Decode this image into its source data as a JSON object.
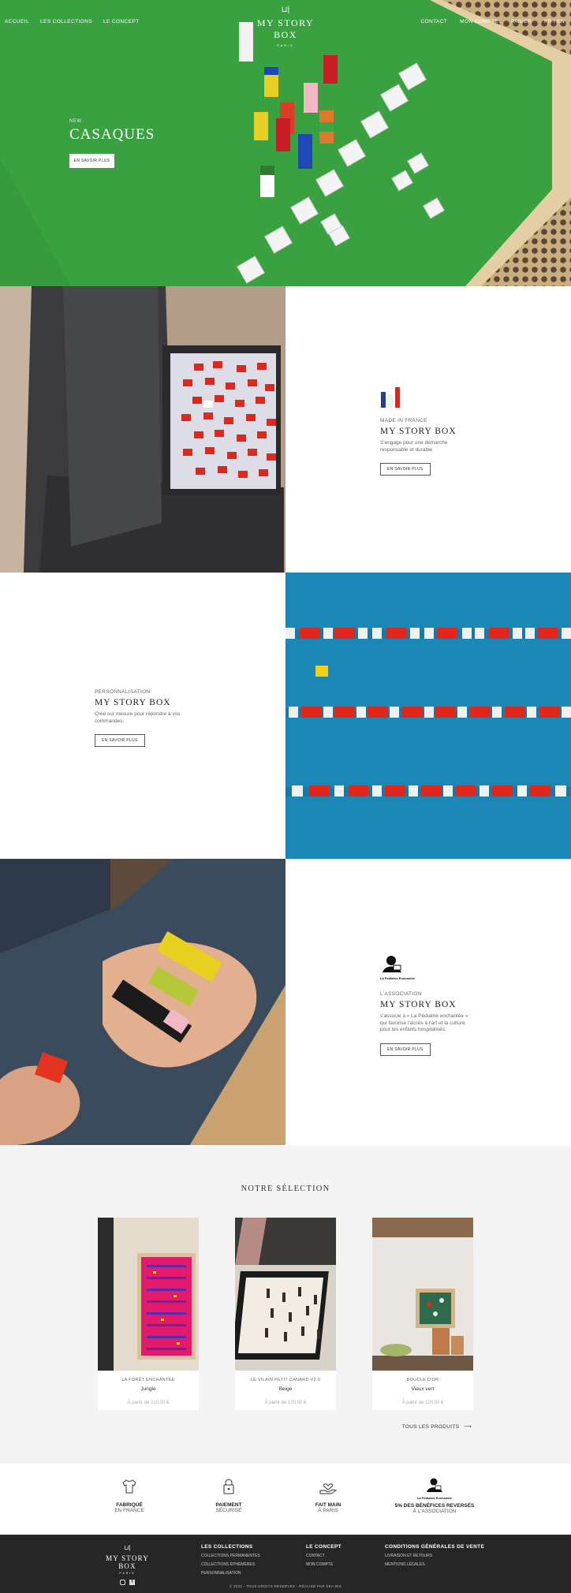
{
  "nav": {
    "left": [
      "ACCUEIL",
      "LES COLLECTIONS",
      "LE CONCEPT"
    ],
    "right": [
      "CONTACT",
      "MON COMPTE",
      "PANIER",
      "FR / EN"
    ]
  },
  "logo": {
    "name": "MY STORY BOX",
    "sub": "PARIS"
  },
  "hero": {
    "kicker": "NEW",
    "title": "CASAQUES",
    "button": "EN SAVOIR PLUS"
  },
  "sections": {
    "made_in_france": {
      "kicker": "MADE IN FRANCE",
      "title": "MY STORY BOX",
      "desc": "S'engage pour une démarche responsable et durable",
      "button": "EN SAVOIR PLUS"
    },
    "personnalisation": {
      "kicker": "PERSONNALISATION",
      "title": "MY STORY BOX",
      "desc": "Créé sur mesure pour répondre à vos commandes.",
      "button": "EN SAVOIR PLUS"
    },
    "association": {
      "logo_text": "La Pédiatrie Enchantée",
      "kicker": "L'ASSOCIATION",
      "title": "MY STORY BOX",
      "desc": "s'associe à « La Pédiatrie enchantée » qui favorise l'accès à l'art et la culture pour les enfants hospitalisés.",
      "button": "EN SAVOIR PLUS"
    }
  },
  "selection": {
    "title": "NOTRE SÉLECTION",
    "products": [
      {
        "collection": "LA FORÊT ENCHANTÉE",
        "name": "Jungle",
        "price": "À partir de 210,00 €"
      },
      {
        "collection": "LE VILAIN PETIT CANARD V2.0",
        "name": "Beige",
        "price": "À partir de 120,00 €"
      },
      {
        "collection": "BOUCLE D'OR",
        "name": "Vieux vert",
        "price": "À partir de 120,00 €"
      }
    ],
    "all_link": "TOUS LES PRODUITS"
  },
  "reassurance": [
    {
      "title": "FABRIQUÉ",
      "sub": "EN FRANCE",
      "icon": "tshirt-icon"
    },
    {
      "title": "PAIEMENT",
      "sub": "SÉCURISÉ",
      "icon": "lock-icon"
    },
    {
      "title": "FAIT MAIN",
      "sub": "À PARIS",
      "icon": "hand-heart-icon"
    },
    {
      "title": "5% DES BÉNÉFICES REVERSÉS",
      "sub": "À L'ASSOCIATION",
      "icon": "association-logo",
      "logo_text": "La Pédiatrie Enchantée"
    }
  ],
  "footer": {
    "logo": {
      "name": "MY STORY BOX",
      "sub": "PARIS"
    },
    "col1": {
      "head": "LES COLLECTIONS",
      "links": [
        "COLLECTIONS PERMANENTES",
        "COLLECTIONS ÉPHÉMÈRES",
        "PERSONNALISATION"
      ]
    },
    "col2": {
      "head": "LE CONCEPT",
      "links": [
        "CONTACT",
        "MON COMPTE"
      ]
    },
    "col3": {
      "head": "CONDITIONS GÉNÉRALES DE VENTE",
      "links": [
        "LIVRAISON ET RETOURS",
        "MENTIONS LÉGALES"
      ]
    },
    "copyright": "© 2022 - TOUS DROITS RÉSERVÉS - RÉALISÉ PAR SEA-BIS"
  },
  "colors": {
    "green": "#2f9e3a",
    "blue": "#1985b4",
    "red": "#e32219",
    "footer": "#262626"
  }
}
